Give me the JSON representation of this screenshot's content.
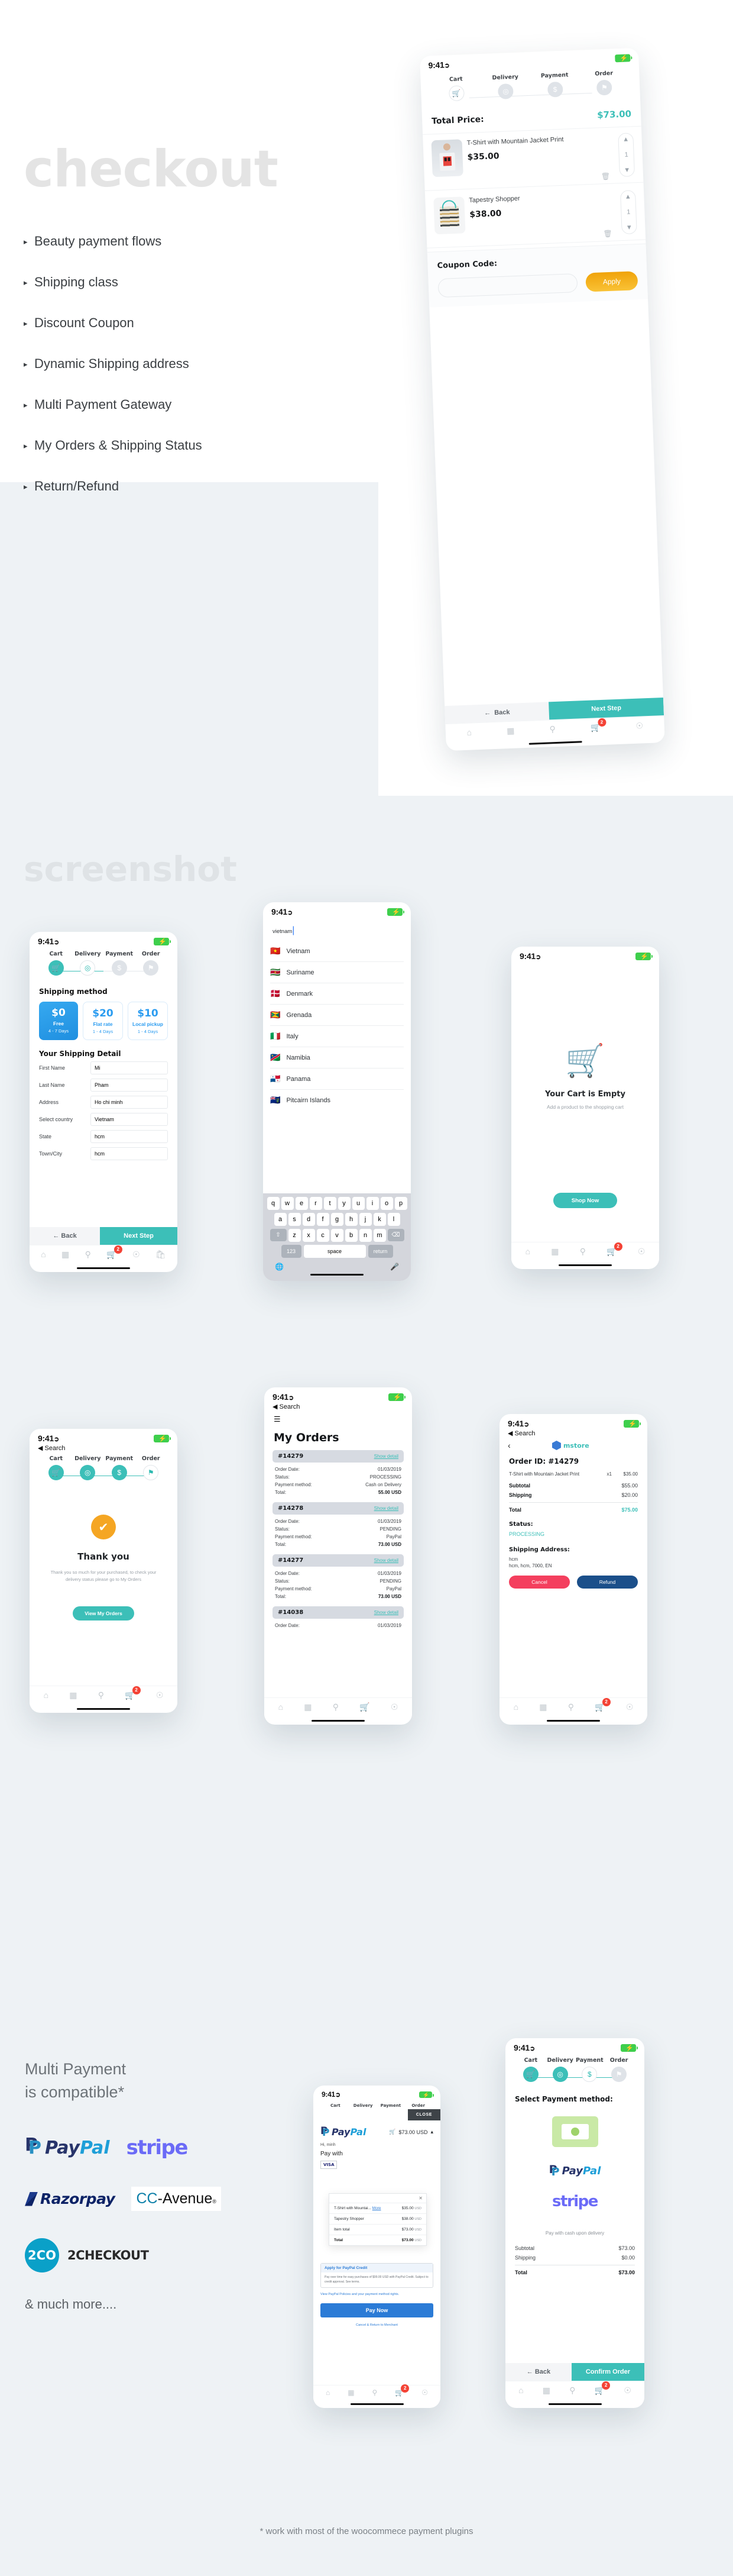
{
  "hero": {
    "word": "checkout",
    "features": [
      "Beauty payment flows",
      "Shipping class",
      " Discount Coupon",
      "Dynamic Shipping address",
      "Multi Payment Gateway",
      "My Orders & Shipping Status",
      "Return/Refund"
    ]
  },
  "section2": {
    "word": "screenshot"
  },
  "status": {
    "time": "9:41",
    "search_back": "◀ Search"
  },
  "steps": {
    "cart": "Cart",
    "delivery": "Delivery",
    "payment": "Payment",
    "order": "Order"
  },
  "cart_screen": {
    "total_label": "Total Price:",
    "total_value": "$73.00",
    "items": [
      {
        "title": "T-Shirt with Mountain Jacket Print",
        "price": "$35.00",
        "qty": "1"
      },
      {
        "title": "Tapestry Shopper",
        "price": "$38.00",
        "qty": "1"
      }
    ],
    "coupon_label": "Coupon Code:",
    "coupon_value": "",
    "coupon_placeholder": "",
    "apply": "Apply",
    "back": "Back",
    "next": "Next Step",
    "cart_badge": "2"
  },
  "shipping_screen": {
    "method_title": "Shipping method",
    "methods": [
      {
        "price": "$0",
        "name": "Free",
        "days": "4 - 7 Days"
      },
      {
        "price": "$20",
        "name": "Flat rate",
        "days": "1 - 4 Days"
      },
      {
        "price": "$10",
        "name": "Local pickup",
        "days": "1 - 4 Days"
      }
    ],
    "detail_title": "Your Shipping Detail",
    "fields": [
      {
        "label": "First Name",
        "value": "Mi"
      },
      {
        "label": "Last Name",
        "value": "Pham"
      },
      {
        "label": "Address",
        "value": "Ho chi minh"
      },
      {
        "label": "Select country",
        "value": "Vietnam"
      },
      {
        "label": "State",
        "value": "hcm"
      },
      {
        "label": "Town/City",
        "value": "hcm"
      }
    ],
    "back": "Back",
    "next": "Next Step",
    "cart_badge": "2"
  },
  "country_screen": {
    "search_value": "vietnam",
    "countries": [
      {
        "flag": "🇻🇳",
        "name": "Vietnam"
      },
      {
        "flag": "🇸🇷",
        "name": "Suriname"
      },
      {
        "flag": "🇩🇰",
        "name": "Denmark"
      },
      {
        "flag": "🇬🇩",
        "name": "Grenada"
      },
      {
        "flag": "🇮🇹",
        "name": "Italy"
      },
      {
        "flag": "🇳🇦",
        "name": "Namibia"
      },
      {
        "flag": "🇵🇦",
        "name": "Panama"
      },
      {
        "flag": "🇵🇳",
        "name": "Pitcairn Islands"
      }
    ],
    "keyboard": {
      "row1": [
        "q",
        "w",
        "e",
        "r",
        "t",
        "y",
        "u",
        "i",
        "o",
        "p"
      ],
      "row2": [
        "a",
        "s",
        "d",
        "f",
        "g",
        "h",
        "j",
        "k",
        "l"
      ],
      "row3": [
        "z",
        "x",
        "c",
        "v",
        "b",
        "n",
        "m"
      ],
      "numbers": "123",
      "space": "space",
      "return": "return"
    }
  },
  "empty_cart_screen": {
    "title": "Your Cart is Empty",
    "subtitle": "Add a product to the shopping cart",
    "button": "Shop Now",
    "cart_badge": "2"
  },
  "thankyou_screen": {
    "title": "Thank you",
    "message": "Thank you so much for your purchased, to check your delivery status please go to My Orders",
    "button": "View My Orders",
    "cart_badge": "2"
  },
  "orders_screen": {
    "title": "My Orders",
    "show_detail": "Show detail",
    "labels": {
      "date": "Order Date:",
      "status": "Status:",
      "method": "Payment method:",
      "total": "Total:"
    },
    "orders": [
      {
        "id": "#14279",
        "date": "01/03/2019",
        "status": "PROCESSING",
        "method": "Cash on Delivery",
        "total": "55.00 USD"
      },
      {
        "id": "#14278",
        "date": "01/03/2019",
        "status": "PENDING",
        "method": "PayPal",
        "total": "73.00 USD"
      },
      {
        "id": "#14277",
        "date": "01/03/2019",
        "status": "PENDING",
        "method": "PayPal",
        "total": "73.00 USD"
      },
      {
        "id": "#14038",
        "date": "01/03/2019",
        "status": "",
        "method": "",
        "total": ""
      }
    ]
  },
  "order_detail_screen": {
    "brand": "mstore",
    "order_id": "Order ID: #14279",
    "line_item": {
      "name": "T-Shirt with Mountain Jacket Print",
      "qty": "x1",
      "price": "$35.00"
    },
    "subtotal_label": "Subtotal",
    "subtotal": "$55.00",
    "shipping_label": "Shipping",
    "shipping": "$20.00",
    "total_label": "Total",
    "total": "$75.00",
    "status_label": "Status:",
    "status": "PROCESSING",
    "address_label": "Shipping Address:",
    "address_line1": "hcm",
    "address_line2": "hcm, hcm, 7000, EN",
    "cancel": "Cancel",
    "refund": "Refund",
    "cart_badge": "2"
  },
  "paypal_screen": {
    "close": "CLOSE",
    "brand": "PayPal",
    "cart_total": "$73.00 USD",
    "greeting": "Hi, minh",
    "pay_with": "Pay with",
    "visa": "VISA",
    "rows": [
      {
        "name": "T-Shirt with Mountai...",
        "more": "More",
        "price": "$35.00",
        "cur": "USD"
      },
      {
        "name": "Tapestry Shopper",
        "more": "",
        "price": "$38.00",
        "cur": "USD"
      },
      {
        "name": "Item total",
        "more": "",
        "price": "$73.00",
        "cur": "USD"
      },
      {
        "name": "Total",
        "more": "",
        "price": "$73.00",
        "cur": "USD"
      }
    ],
    "credit_title": "Apply for PayPal Credit",
    "credit_text": "Pay over time for easy purchases of $99.00 USD with PayPal Credit. Subject to credit approval. See terms.",
    "policy": "View PayPal Policies and your payment method rights.",
    "pay_now": "Pay Now",
    "footer": "Cancel & Return to Merchant",
    "cart_badge": "2"
  },
  "payment_method_screen": {
    "title": "Select Payment method:",
    "cod_note": "Pay with cash upon delivery",
    "subtotal_label": "Subtotal",
    "subtotal": "$73.00",
    "shipping_label": "Shipping",
    "shipping": "$0.00",
    "total_label": "Total",
    "total": "$73.00",
    "back": "Back",
    "confirm": "Confirm Order",
    "paypal": "PayPal",
    "stripe": "stripe",
    "cart_badge": "2"
  },
  "payments": {
    "heading_line1": "Multi Payment",
    "heading_line2": "is compatible*",
    "much_more": "& much more....",
    "footnote": "* work with most of the woocommece payment plugins",
    "logos": [
      "PayPal",
      "stripe",
      "Razorpay",
      "CC-Avenue",
      "2CHECKOUT"
    ]
  },
  "colors": {
    "teal": "#3cbfb8",
    "orange": "#f5a623",
    "blue": "#2b9cf0",
    "red": "#f43f5e",
    "navy": "#1b4f8a"
  }
}
